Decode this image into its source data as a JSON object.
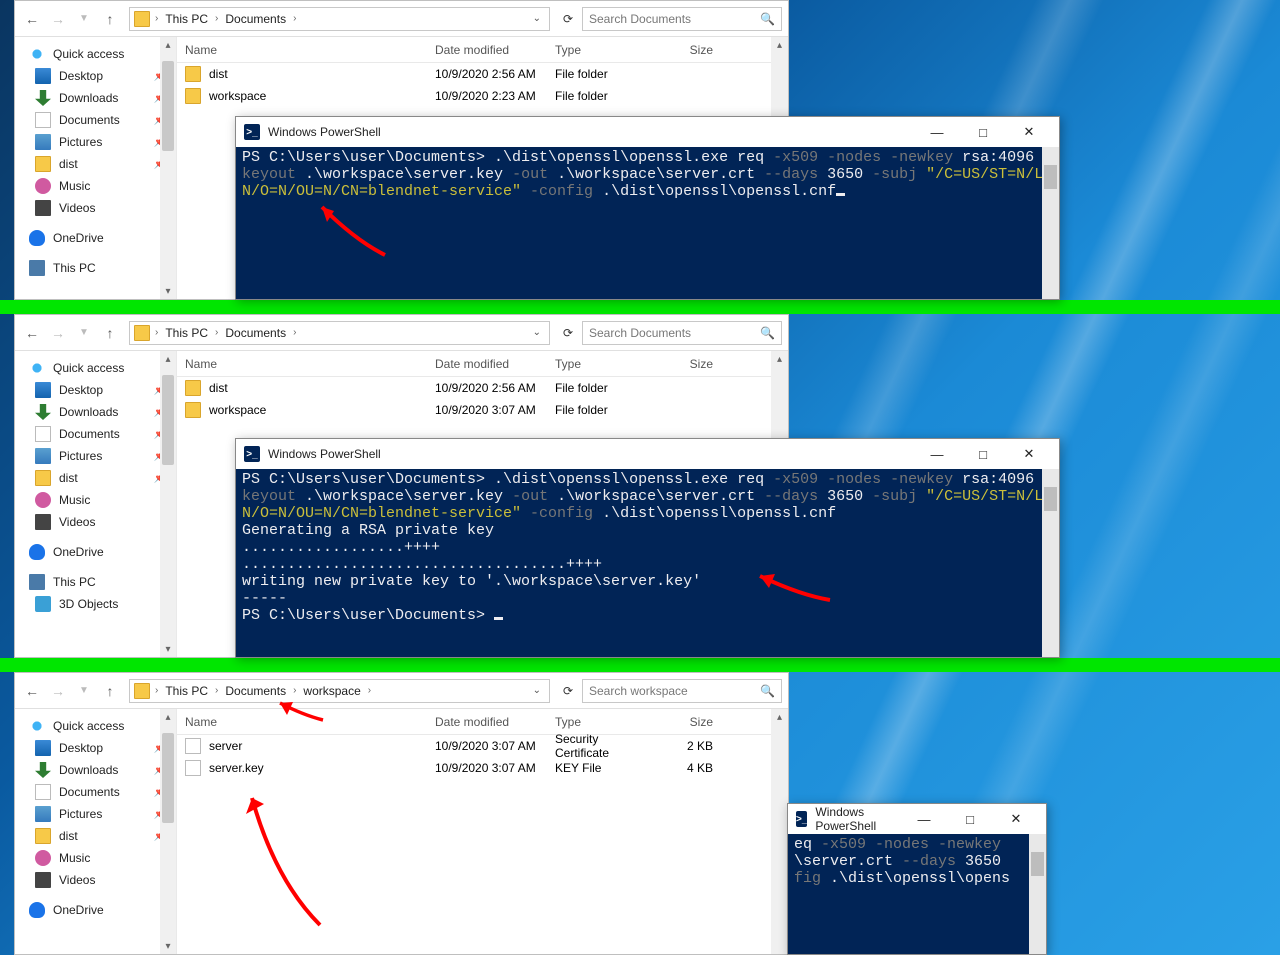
{
  "panels": [
    {
      "breadcrumb": [
        "This PC",
        "Documents"
      ],
      "search_placeholder": "Search Documents",
      "columns": [
        "Name",
        "Date modified",
        "Type",
        "Size"
      ],
      "rows": [
        {
          "icon": "folder",
          "name": "dist",
          "date": "10/9/2020 2:56 AM",
          "type": "File folder",
          "size": ""
        },
        {
          "icon": "folder",
          "name": "workspace",
          "date": "10/9/2020 2:23 AM",
          "type": "File folder",
          "size": ""
        }
      ],
      "sidebar": [
        {
          "kind": "header",
          "icon": "star",
          "label": "Quick access"
        },
        {
          "icon": "desktop",
          "label": "Desktop",
          "pinned": true
        },
        {
          "icon": "arrowdown",
          "label": "Downloads",
          "pinned": true
        },
        {
          "icon": "doc",
          "label": "Documents",
          "pinned": true
        },
        {
          "icon": "pic",
          "label": "Pictures",
          "pinned": true
        },
        {
          "icon": "folder",
          "label": "dist",
          "pinned": true
        },
        {
          "icon": "music",
          "label": "Music"
        },
        {
          "icon": "video",
          "label": "Videos"
        },
        {
          "kind": "gap"
        },
        {
          "kind": "header",
          "icon": "cloud",
          "label": "OneDrive"
        },
        {
          "kind": "gap"
        },
        {
          "kind": "header",
          "icon": "pc",
          "label": "This PC"
        }
      ]
    },
    {
      "breadcrumb": [
        "This PC",
        "Documents"
      ],
      "search_placeholder": "Search Documents",
      "columns": [
        "Name",
        "Date modified",
        "Type",
        "Size"
      ],
      "rows": [
        {
          "icon": "folder",
          "name": "dist",
          "date": "10/9/2020 2:56 AM",
          "type": "File folder",
          "size": ""
        },
        {
          "icon": "folder",
          "name": "workspace",
          "date": "10/9/2020 3:07 AM",
          "type": "File folder",
          "size": ""
        }
      ],
      "sidebar": [
        {
          "kind": "header",
          "icon": "star",
          "label": "Quick access"
        },
        {
          "icon": "desktop",
          "label": "Desktop",
          "pinned": true
        },
        {
          "icon": "arrowdown",
          "label": "Downloads",
          "pinned": true
        },
        {
          "icon": "doc",
          "label": "Documents",
          "pinned": true
        },
        {
          "icon": "pic",
          "label": "Pictures",
          "pinned": true
        },
        {
          "icon": "folder",
          "label": "dist",
          "pinned": true
        },
        {
          "icon": "music",
          "label": "Music"
        },
        {
          "icon": "video",
          "label": "Videos"
        },
        {
          "kind": "gap"
        },
        {
          "kind": "header",
          "icon": "cloud",
          "label": "OneDrive"
        },
        {
          "kind": "gap"
        },
        {
          "kind": "header",
          "icon": "pc",
          "label": "This PC"
        },
        {
          "icon": "obj",
          "label": "3D Objects"
        }
      ]
    },
    {
      "breadcrumb": [
        "This PC",
        "Documents",
        "workspace"
      ],
      "search_placeholder": "Search workspace",
      "columns": [
        "Name",
        "Date modified",
        "Type",
        "Size"
      ],
      "rows": [
        {
          "icon": "cert",
          "name": "server",
          "date": "10/9/2020 3:07 AM",
          "type": "Security Certificate",
          "size": "2 KB"
        },
        {
          "icon": "file",
          "name": "server.key",
          "date": "10/9/2020 3:07 AM",
          "type": "KEY File",
          "size": "4 KB"
        }
      ],
      "sidebar": [
        {
          "kind": "header",
          "icon": "star",
          "label": "Quick access"
        },
        {
          "icon": "desktop",
          "label": "Desktop",
          "pinned": true
        },
        {
          "icon": "arrowdown",
          "label": "Downloads",
          "pinned": true
        },
        {
          "icon": "doc",
          "label": "Documents",
          "pinned": true
        },
        {
          "icon": "pic",
          "label": "Pictures",
          "pinned": true
        },
        {
          "icon": "folder",
          "label": "dist",
          "pinned": true
        },
        {
          "icon": "music",
          "label": "Music"
        },
        {
          "icon": "video",
          "label": "Videos"
        },
        {
          "kind": "gap"
        },
        {
          "kind": "header",
          "icon": "cloud",
          "label": "OneDrive"
        }
      ]
    }
  ],
  "powershell": {
    "title": "Windows PowerShell",
    "prompt": "PS C:\\Users\\user\\Documents> ",
    "cmd_segments": [
      {
        "c": "w",
        "t": ".\\dist\\openssl\\openssl.exe req "
      },
      {
        "c": "g",
        "t": "-x509 -nodes -newkey"
      },
      {
        "c": "w",
        "t": " rsa:4096 "
      },
      {
        "c": "g",
        "t": "-keyout"
      },
      {
        "c": "w",
        "t": " .\\workspace\\server.key "
      },
      {
        "c": "g",
        "t": "-out"
      },
      {
        "c": "w",
        "t": " .\\workspace\\server.crt "
      },
      {
        "c": "g",
        "t": "--days"
      },
      {
        "c": "w",
        "t": " 3650 "
      },
      {
        "c": "g",
        "t": "-subj "
      },
      {
        "c": "y",
        "t": "\"/C=US/ST=N/L=N/O=N/OU=N/CN=blendnet-service\""
      },
      {
        "c": "g",
        "t": " -config"
      },
      {
        "c": "w",
        "t": " .\\dist\\openssl\\openssl.cnf"
      }
    ],
    "output_lines": [
      "Generating a RSA private key",
      "..................++++",
      "....................................++++",
      "writing new private key to '.\\workspace\\server.key'",
      "-----"
    ],
    "partial_right": [
      {
        "c": "w",
        "t": "eq "
      },
      {
        "c": "g",
        "t": "-x509 -nodes -newkey"
      },
      {
        "c": "w",
        "t": "\n\\server.crt "
      },
      {
        "c": "g",
        "t": "--days"
      },
      {
        "c": "w",
        "t": " 3650"
      },
      {
        "c": "g",
        "t": "\nfig"
      },
      {
        "c": "w",
        "t": " .\\dist\\openssl\\opens"
      }
    ]
  }
}
